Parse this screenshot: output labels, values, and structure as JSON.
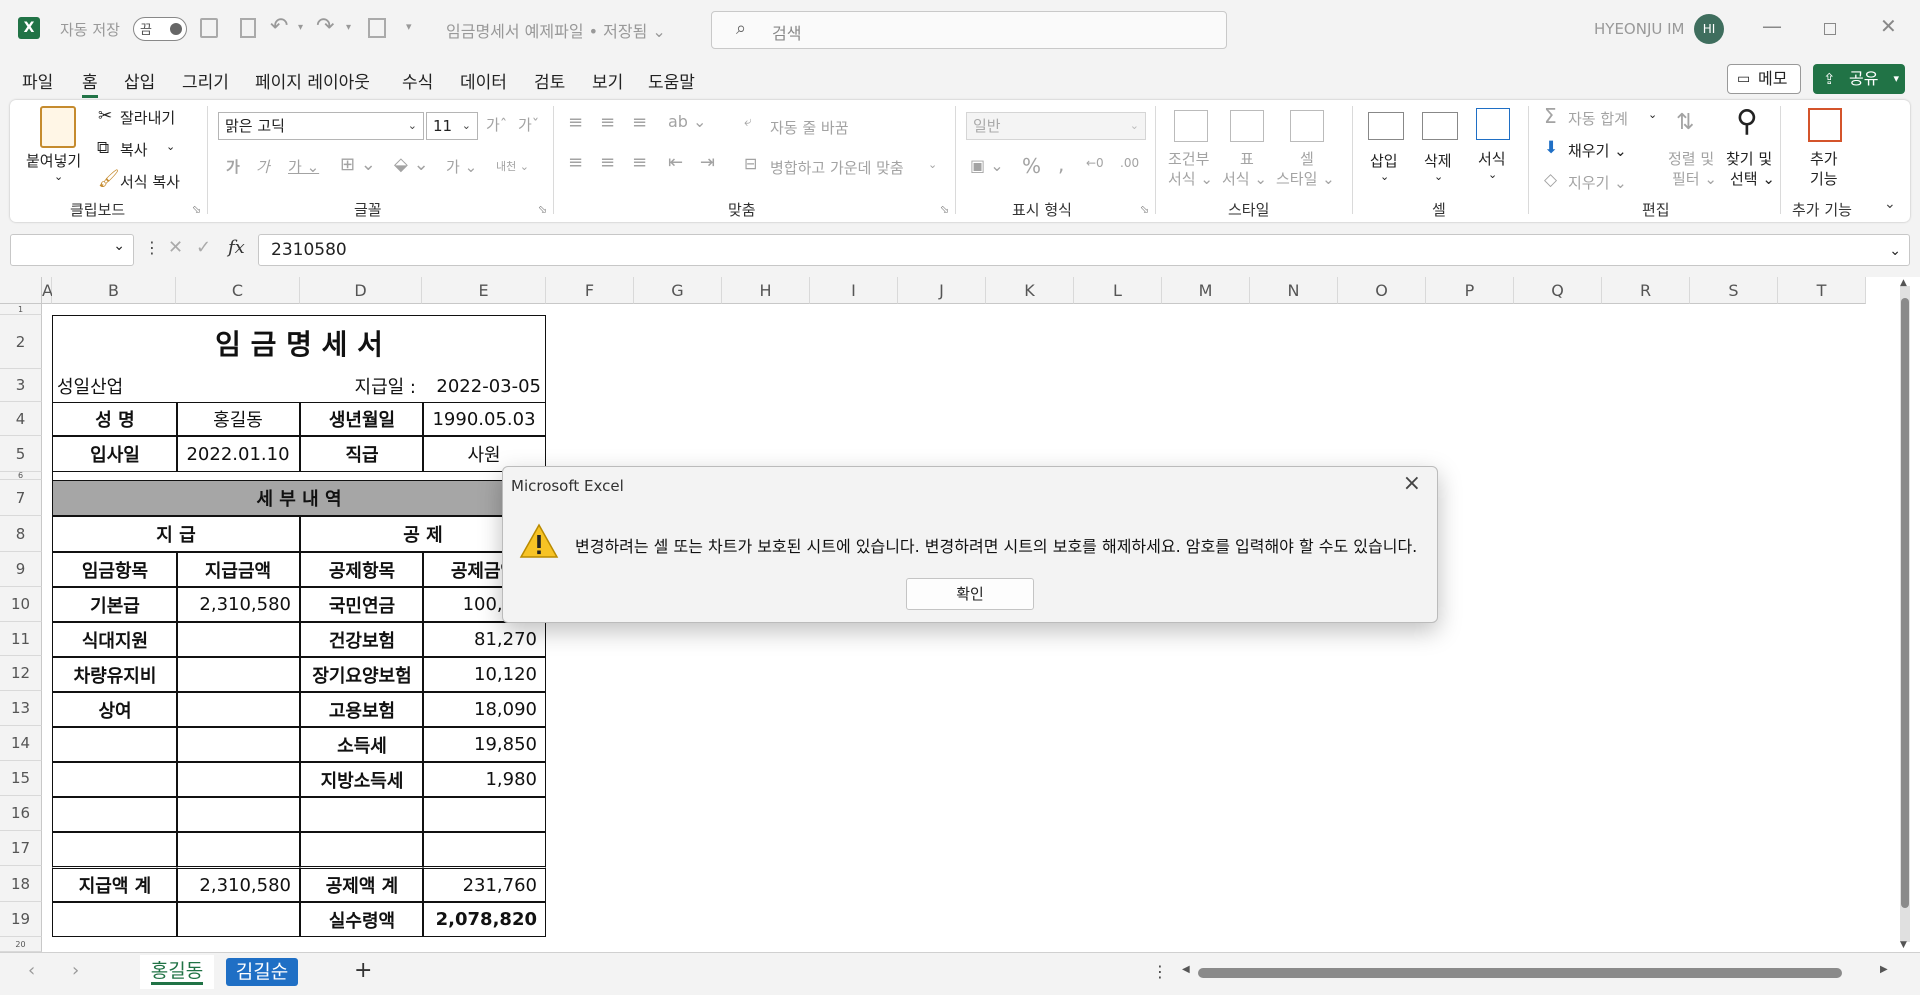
{
  "titlebar": {
    "autosave_label": "자동 저장",
    "autosave_state": "끔",
    "doc_title": "임금명세서 예제파일 • 저장됨",
    "search_placeholder": "검색",
    "user_name": "HYEONJU IM",
    "user_initials": "HI"
  },
  "menu": {
    "items": [
      "파일",
      "홈",
      "삽입",
      "그리기",
      "페이지 레이아웃",
      "수식",
      "데이터",
      "검토",
      "보기",
      "도움말"
    ],
    "memo_label": "메모",
    "share_label": "공유"
  },
  "ribbon": {
    "clipboard": {
      "paste": "붙여넣기",
      "cut": "잘라내기",
      "copy": "복사",
      "format_painter": "서식 복사",
      "label": "클립보드"
    },
    "font": {
      "name": "맑은 고딕",
      "size": "11",
      "label": "글꼴"
    },
    "alignment": {
      "wrap": "자동 줄 바꿈",
      "merge": "병합하고 가운데 맞춤",
      "label": "맞춤"
    },
    "number": {
      "format": "일반",
      "label": "표시 형식"
    },
    "styles": {
      "conditional": "조건부",
      "conditional2": "서식",
      "table": "표",
      "table2": "서식",
      "cell": "셀",
      "cell2": "스타일",
      "label": "스타일"
    },
    "cells": {
      "insert": "삽입",
      "delete": "삭제",
      "format": "서식",
      "label": "셀"
    },
    "editing": {
      "autosum": "자동 합계",
      "fill": "채우기",
      "clear": "지우기",
      "sort": "정렬 및",
      "sort2": "필터",
      "find": "찾기 및",
      "find2": "선택",
      "label": "편집"
    },
    "addins": {
      "btn": "추가",
      "btn2": "기능",
      "label": "추가 기능"
    }
  },
  "formula_bar": {
    "value": "2310580",
    "fx": "fx"
  },
  "columns": [
    "A",
    "B",
    "C",
    "D",
    "E",
    "F",
    "G",
    "H",
    "I",
    "J",
    "K",
    "L",
    "M",
    "N",
    "O",
    "P",
    "Q",
    "R",
    "S",
    "T"
  ],
  "rows": [
    "1",
    "2",
    "3",
    "4",
    "5",
    "6",
    "7",
    "8",
    "9",
    "10",
    "11",
    "12",
    "13",
    "14",
    "15",
    "16",
    "17",
    "18",
    "19",
    "20"
  ],
  "sheet": {
    "title": "임 금 명 세 서",
    "company": "성일산업",
    "pay_date_label": "지급일 :",
    "pay_date": "2022-03-05",
    "name_label": "성    명",
    "name": "홍길동",
    "birth_label": "생년월일",
    "birth": "1990.05.03",
    "join_label": "입사일",
    "join": "2022.01.10",
    "rank_label": "직급",
    "rank": "사원",
    "detail_header": "세     부     내     역",
    "pay_header": "지     급",
    "deduct_header": "공     제",
    "col_pay_item": "임금항목",
    "col_pay_amount": "지급금액",
    "col_ded_item": "공제항목",
    "col_ded_amount": "공제금액",
    "lines": [
      {
        "pay_item": "기본급",
        "pay_amount": "2,310,580",
        "ded_item": "국민연금",
        "ded_amount": "100,450"
      },
      {
        "pay_item": "식대지원",
        "pay_amount": "",
        "ded_item": "건강보험",
        "ded_amount": "81,270"
      },
      {
        "pay_item": "차량유지비",
        "pay_amount": "",
        "ded_item": "장기요양보험",
        "ded_amount": "10,120"
      },
      {
        "pay_item": "상여",
        "pay_amount": "",
        "ded_item": "고용보험",
        "ded_amount": "18,090"
      },
      {
        "pay_item": "",
        "pay_amount": "",
        "ded_item": "소득세",
        "ded_amount": "19,850"
      },
      {
        "pay_item": "",
        "pay_amount": "",
        "ded_item": "지방소득세",
        "ded_amount": "1,980"
      },
      {
        "pay_item": "",
        "pay_amount": "",
        "ded_item": "",
        "ded_amount": ""
      },
      {
        "pay_item": "",
        "pay_amount": "",
        "ded_item": "",
        "ded_amount": ""
      }
    ],
    "total_pay_label": "지급액 계",
    "total_pay": "2,310,580",
    "total_ded_label": "공제액 계",
    "total_ded": "231,760",
    "net_label": "실수령액",
    "net": "2,078,820"
  },
  "tabs": [
    "홍길동",
    "김길순"
  ],
  "dialog": {
    "title": "Microsoft Excel",
    "message": "변경하려는 셀 또는 차트가 보호된 시트에 있습니다. 변경하려면 시트의 보호를 해제하세요. 암호를 입력해야 할 수도 있습니다.",
    "ok_label": "확인"
  },
  "colors": {
    "accent": "#217346",
    "tab_active_bg": "#1f6fc5",
    "header_band": "#a6a6a6"
  }
}
